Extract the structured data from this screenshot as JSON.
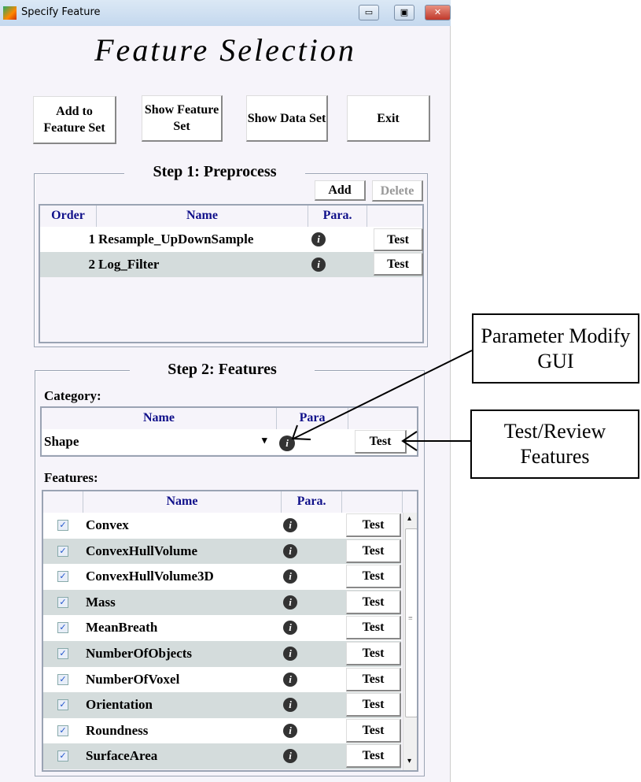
{
  "window": {
    "title": "Specify Feature",
    "minimize": "▭",
    "maximize": "▣",
    "close": "✕"
  },
  "heading": "Feature Selection",
  "toolbar": {
    "add_to_feature_set": "Add to Feature Set",
    "show_feature_set": "Show Feature Set",
    "show_data_set": "Show Data Set",
    "exit": "Exit"
  },
  "step1": {
    "legend": "Step 1: Preprocess",
    "add": "Add",
    "delete": "Delete",
    "columns": [
      "Order",
      "Name",
      "Para."
    ],
    "rows": [
      {
        "order": "1",
        "name": "Resample_UpDownSample",
        "test": "Test"
      },
      {
        "order": "2",
        "name": "Log_Filter",
        "test": "Test"
      }
    ]
  },
  "step2": {
    "legend": "Step 2: Features",
    "category_label": "Category:",
    "category_columns": [
      "Name",
      "Para"
    ],
    "category_value": "Shape",
    "category_test": "Test",
    "features_label": "Features:",
    "feature_columns": [
      "Name",
      "Para."
    ],
    "features": [
      {
        "name": "Convex",
        "checked": true,
        "test": "Test"
      },
      {
        "name": "ConvexHullVolume",
        "checked": true,
        "test": "Test"
      },
      {
        "name": "ConvexHullVolume3D",
        "checked": true,
        "test": "Test"
      },
      {
        "name": "Mass",
        "checked": true,
        "test": "Test"
      },
      {
        "name": "MeanBreath",
        "checked": true,
        "test": "Test"
      },
      {
        "name": "NumberOfObjects",
        "checked": true,
        "test": "Test"
      },
      {
        "name": "NumberOfVoxel",
        "checked": true,
        "test": "Test"
      },
      {
        "name": "Orientation",
        "checked": true,
        "test": "Test"
      },
      {
        "name": "Roundness",
        "checked": true,
        "test": "Test"
      },
      {
        "name": "SurfaceArea",
        "checked": true,
        "test": "Test"
      }
    ]
  },
  "annotations": {
    "param": "Parameter Modify GUI",
    "test": "Test/Review Features"
  },
  "icons": {
    "info": "i",
    "check": "✓",
    "dropdown": "▾",
    "scroll_up": "▴",
    "scroll_down": "▾",
    "scroll_grip": "≡"
  }
}
